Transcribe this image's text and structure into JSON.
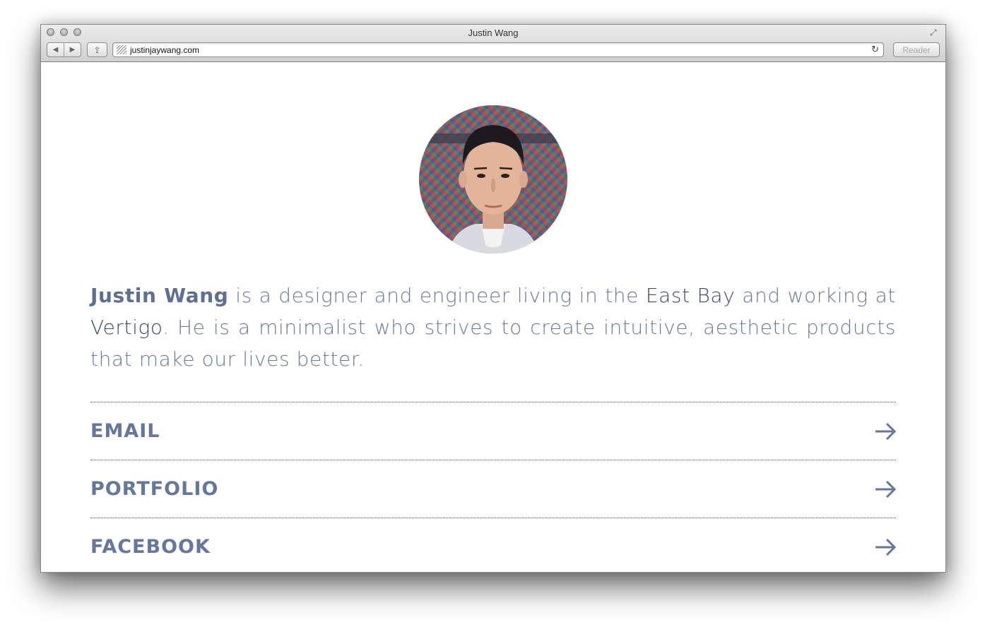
{
  "window": {
    "title": "Justin Wang",
    "url": "justinjaywang.com",
    "reader_label": "Reader",
    "back_glyph": "◀",
    "forward_glyph": "▶",
    "share_glyph": "⇪",
    "reload_glyph": "↻",
    "fullscreen_glyph": "⤢"
  },
  "profile": {
    "avatar_description": "avatar-photo"
  },
  "bio": {
    "name": "Justin Wang",
    "part1": " is a designer and engineer living in the ",
    "place1": "East Bay",
    "part2": " and working at ",
    "place2": "Vertigo",
    "part3": ". He is a minimalist who strives to create intuitive, aesthetic products that make our lives better."
  },
  "links": [
    {
      "label": "EMAIL"
    },
    {
      "label": "PORTFOLIO"
    },
    {
      "label": "FACEBOOK"
    }
  ],
  "colors": {
    "text": "#6b7a98",
    "emphasis": "#3c4a66",
    "link": "#66779a"
  }
}
